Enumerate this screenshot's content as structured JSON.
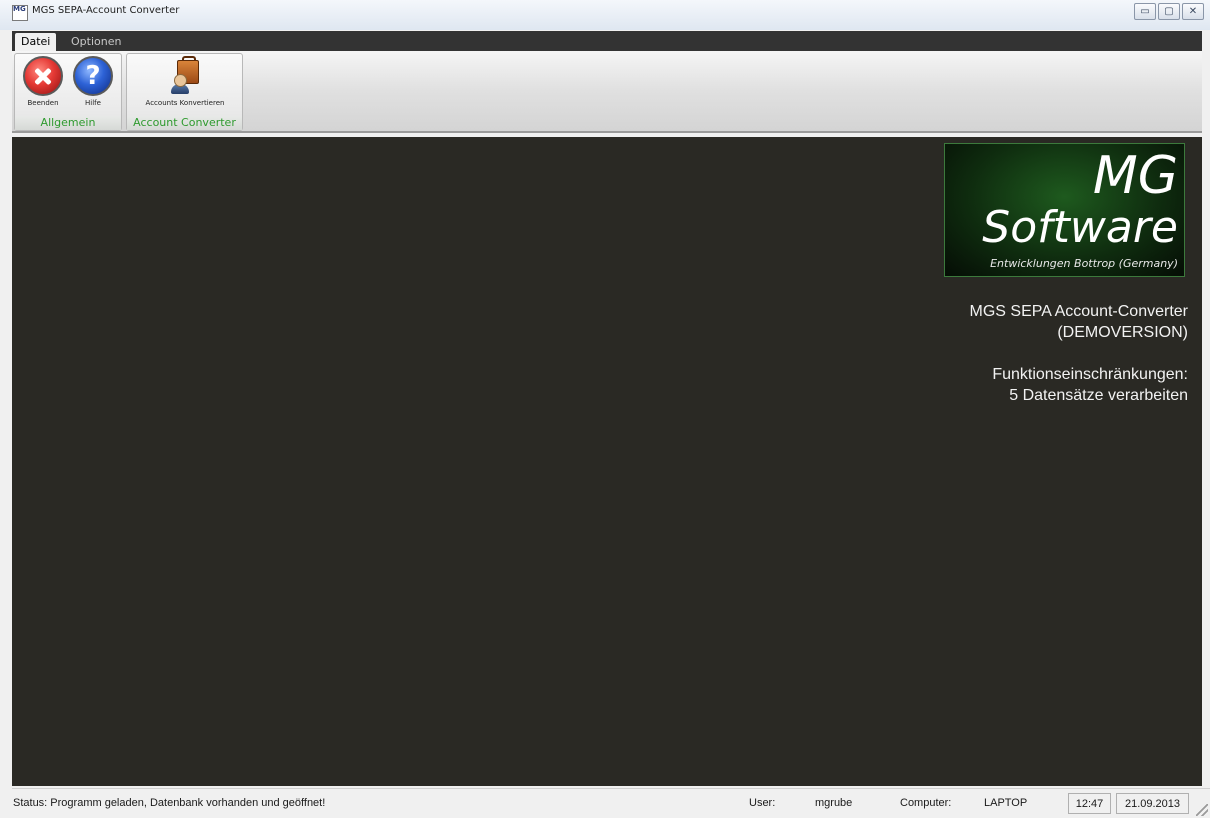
{
  "window": {
    "title": "MGS SEPA-Account Converter",
    "app_icon_text": "MG",
    "buttons": {
      "minimize": "▭",
      "maximize": "▢",
      "close": "✕"
    }
  },
  "menu": {
    "tabs": [
      {
        "label": "Datei",
        "active": true
      },
      {
        "label": "Optionen",
        "active": false
      }
    ]
  },
  "ribbon": {
    "groups": [
      {
        "label": "Allgemein",
        "buttons": [
          {
            "label": "Beenden",
            "icon": "close-circle-red-icon"
          },
          {
            "label": "Hilfe",
            "icon": "help-circle-blue-icon",
            "glyph": "?"
          }
        ]
      },
      {
        "label": "Account Converter",
        "buttons": [
          {
            "label": "Accounts Konvertieren",
            "icon": "account-briefcase-icon"
          }
        ]
      }
    ],
    "label_color": "#2e9a2e"
  },
  "content": {
    "background": "#2a2924",
    "logo": {
      "line1": "MG",
      "line2": "Software",
      "line3": "Entwicklungen Bottrop (Germany)"
    },
    "info": {
      "line1": "MGS SEPA Account-Converter",
      "line2": "(DEMOVERSION)",
      "line3": "Funktionseinschränkungen:",
      "line4": "5 Datensätze verarbeiten"
    }
  },
  "statusbar": {
    "status": "Status: Programm geladen, Datenbank vorhanden und geöffnet!",
    "user_label": "User:",
    "user_value": "mgrube",
    "computer_label": "Computer:",
    "computer_value": "LAPTOP",
    "time": "12:47",
    "date": "21.09.2013"
  }
}
